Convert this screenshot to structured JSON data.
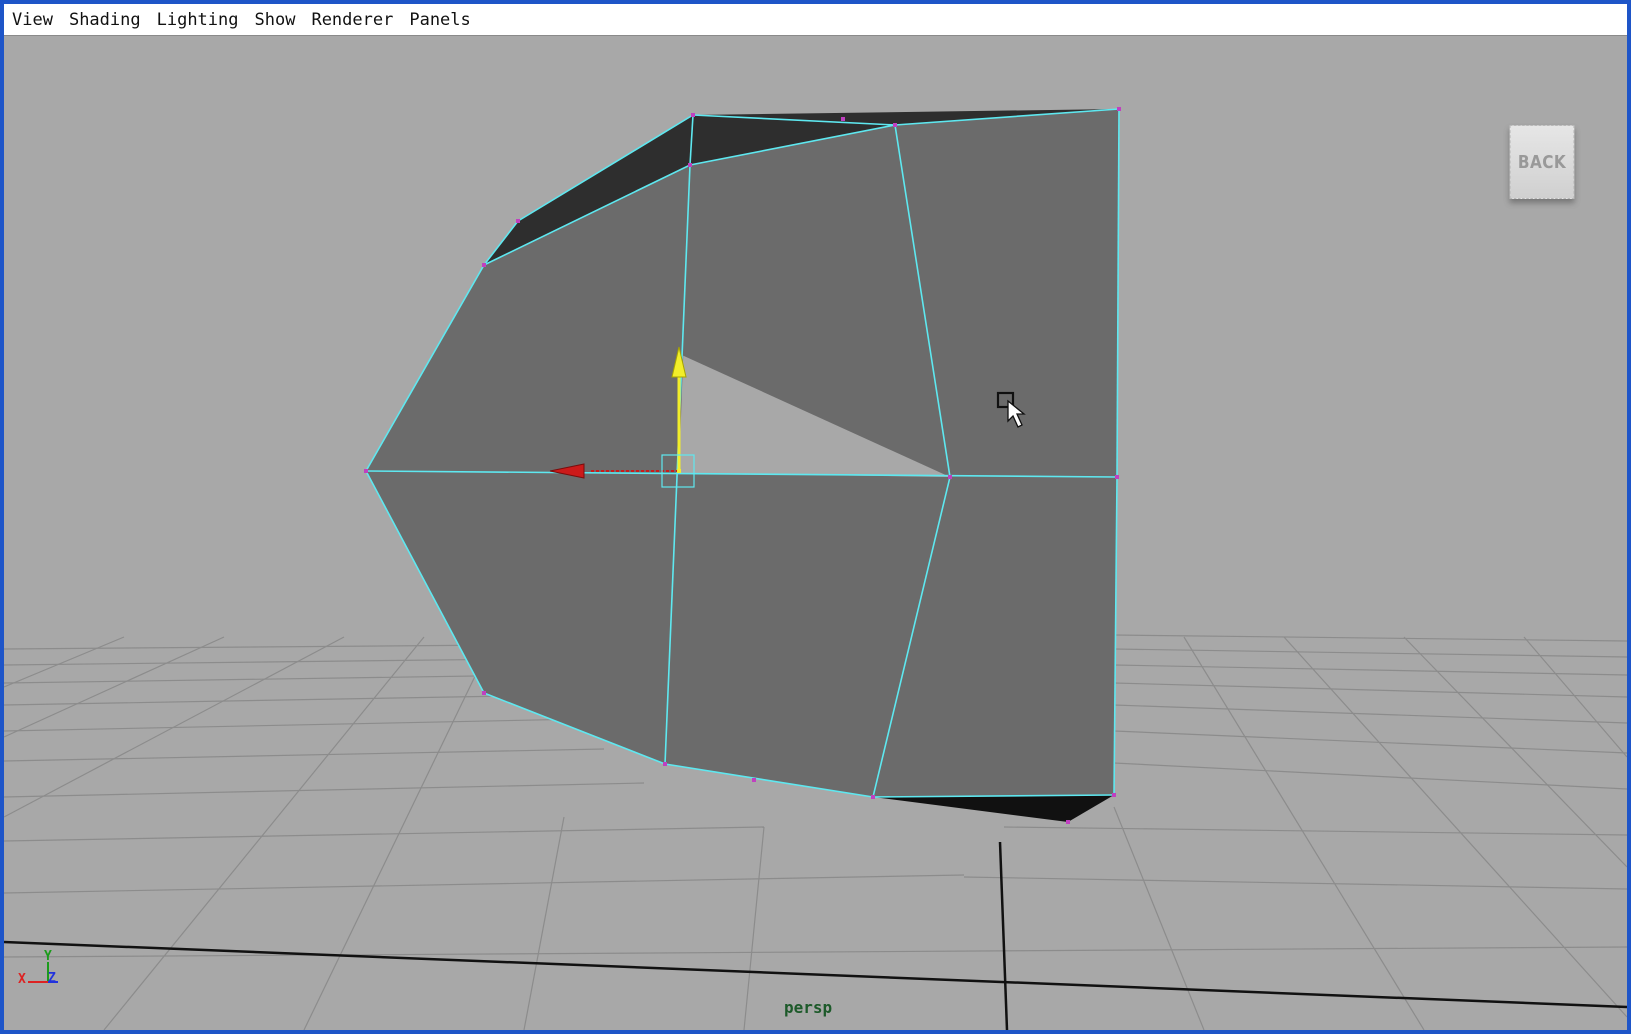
{
  "menubar": {
    "items": [
      {
        "label": "View"
      },
      {
        "label": "Shading"
      },
      {
        "label": "Lighting"
      },
      {
        "label": "Show"
      },
      {
        "label": "Renderer"
      },
      {
        "label": "Panels"
      }
    ]
  },
  "viewport": {
    "back_button": "BACK",
    "camera_name": "persp",
    "axis_labels": {
      "x": "X",
      "y": "Y",
      "z": "Z"
    },
    "colors": {
      "background": "#a8a8a8",
      "mesh_face": "#6b6b6b",
      "mesh_dark": "#2e2e2e",
      "wireframe": "#5ee8f0",
      "vertex": "#c040c0",
      "grid": "#8c8c8c",
      "manip_y": "#f2ee2a",
      "manip_x": "#cc1a1a"
    },
    "icons": [
      "move-manipulator-icon",
      "select-cursor-icon",
      "axis-gizmo-icon"
    ]
  }
}
